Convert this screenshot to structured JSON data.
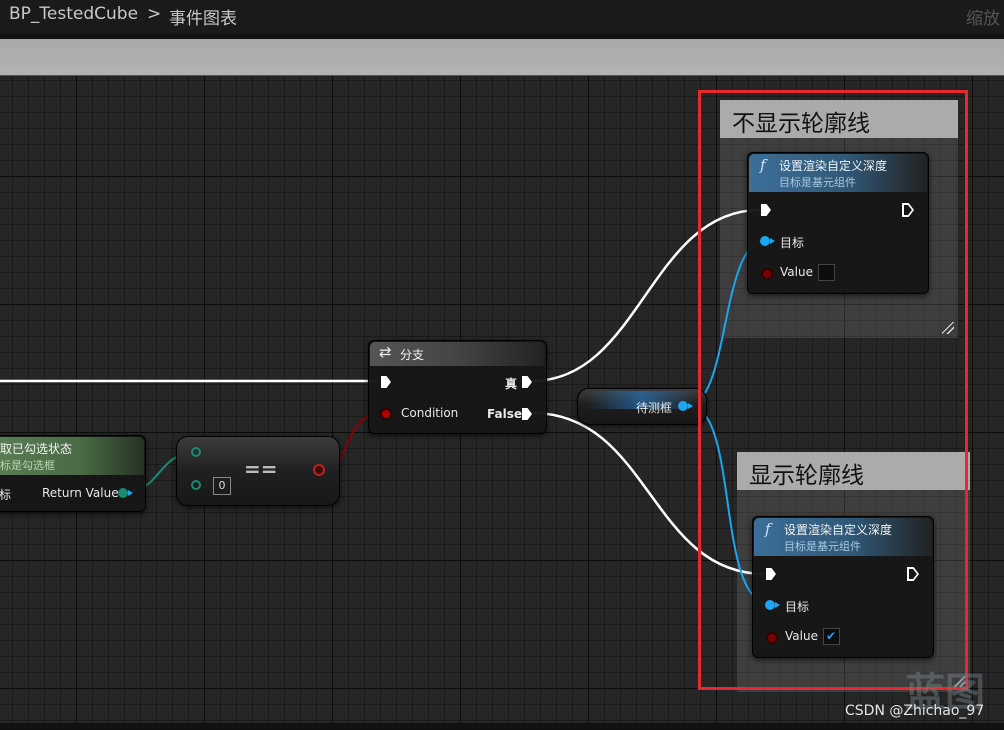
{
  "titlebar": {
    "breadcrumb_root": "BP_TestedCube",
    "breadcrumb_separator": ">",
    "breadcrumb_current": "事件图表",
    "zoom_label": "缩放"
  },
  "comments": [
    {
      "title": "不显示轮廓线"
    },
    {
      "title": "显示轮廓线"
    }
  ],
  "nodes": {
    "get_checked": {
      "title": "取已勾选状态",
      "subtitle": "标是勾选框",
      "target_label": "标",
      "return_label": "Return Value"
    },
    "equal": {
      "operator": "==",
      "literal": "0"
    },
    "branch": {
      "title": "分支",
      "true_label": "真",
      "condition_label": "Condition",
      "false_label": "False"
    },
    "var_get": {
      "label": "待测框"
    },
    "set_depth_top": {
      "title": "设置渲染自定义深度",
      "subtitle": "目标是基元组件",
      "target_label": "目标",
      "value_label": "Value",
      "value_checked": false
    },
    "set_depth_bottom": {
      "title": "设置渲染自定义深度",
      "subtitle": "目标是基元组件",
      "target_label": "目标",
      "value_label": "Value",
      "value_checked": true
    }
  },
  "icons": {
    "function": "f-function-icon",
    "branch": "branch-icon",
    "checkmark": "checkmark-icon"
  },
  "colors": {
    "exec_wire": "#ffffff",
    "object_pin": "#1aa6f0",
    "bool_pin": "#8a0000",
    "highlight_frame": "#e42a2a",
    "function_header": "#3b6f99",
    "pure_header": "#4a6b45"
  },
  "watermark": {
    "text": "CSDN @Zhichao_97",
    "logo_text": "蓝图"
  }
}
